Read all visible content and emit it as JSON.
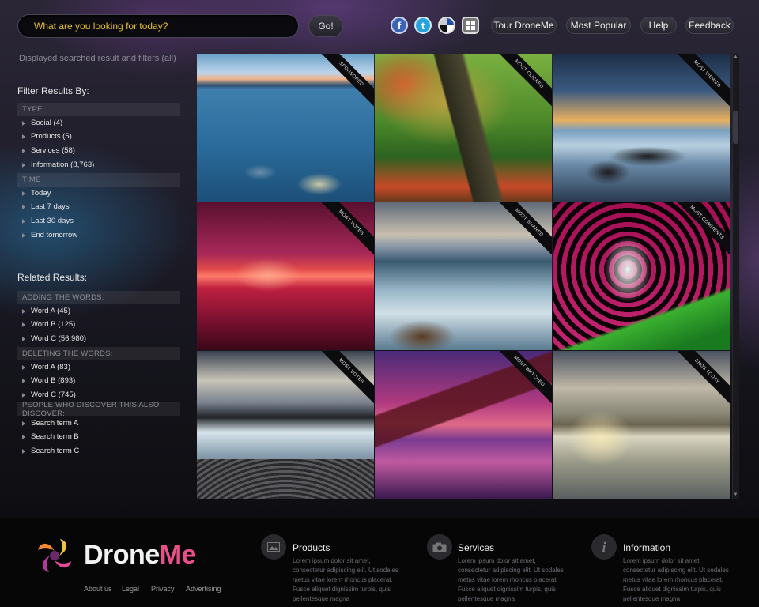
{
  "header": {
    "search_placeholder": "What are you looking for today?",
    "go_label": "Go!",
    "social": [
      {
        "name": "facebook-icon",
        "glyph": "f",
        "color": "#3b63b8"
      },
      {
        "name": "twitter-icon",
        "glyph": "t",
        "color": "#2aa3dc"
      },
      {
        "name": "delicious-icon",
        "glyph": "",
        "color": "#ffffff"
      },
      {
        "name": "bookmark-icon",
        "glyph": "",
        "color": "#9a9a9a"
      }
    ],
    "nav": [
      "Tour DroneMe",
      "Most Popular",
      "Help",
      "Feedback"
    ]
  },
  "sidebar": {
    "subtitle": "Displayed searched result and filters (all)",
    "filter_heading": "Filter Results By:",
    "type_head": "TYPE",
    "type_items": [
      "Social (4)",
      "Products (5)",
      "Services (58)",
      "Information (8,763)"
    ],
    "time_head": "TIME",
    "time_items": [
      "Today",
      "Last 7 days",
      "Last 30 days",
      "End tomorrow"
    ],
    "related_heading": "Related Results:",
    "adding_head": "ADDING THE WORDS:",
    "adding_items": [
      "Word A (45)",
      "Word B (125)",
      "Word C (56,980)"
    ],
    "deleting_head": "DELETING THE WORDS:",
    "deleting_items": [
      "Word A (83)",
      "Word B (893)",
      "Word C (745)"
    ],
    "discover_head": "PEOPLE WHO DISCOVER THIS ALSO DISCOVER:",
    "discover_items": [
      "Search term A",
      "Search term B",
      "Search term C"
    ]
  },
  "results": [
    {
      "ribbon": "SPONSORED",
      "scene": "lake-stones"
    },
    {
      "ribbon": "MOST CLICKED",
      "scene": "tree"
    },
    {
      "ribbon": "MOST VIEWED",
      "scene": "rocky-shore"
    },
    {
      "ribbon": "MOST VOTES",
      "scene": "bridge-night"
    },
    {
      "ribbon": "MOST SHARED",
      "scene": "waves"
    },
    {
      "ribbon": "MOST COMMENTS",
      "scene": "butterfly"
    },
    {
      "ribbon": "MOST VOTES",
      "scene": "pebble-beach"
    },
    {
      "ribbon": "MOST WATCHED",
      "scene": "forth-bridge"
    },
    {
      "ribbon": "ENDS TODAY",
      "scene": "town-reflection"
    }
  ],
  "footer": {
    "logo_part1": "Drone",
    "logo_part2": "Me",
    "links": [
      "About us",
      "Legal",
      "Privacy",
      "Advertising"
    ],
    "columns": [
      {
        "icon": "image-icon",
        "title": "Products",
        "text": "Lorem ipsum dolor sit amet, consectetur adipiscing elit. Ut sodales metus vitae lorem rhoncus placerat. Fusce aliquet dignissim turpis, quis pellentesque magna"
      },
      {
        "icon": "camera-icon",
        "title": "Services",
        "text": "Lorem ipsum dolor sit amet, consectetur adipiscing elit. Ut sodales metus vitae lorem rhoncus placerat. Fusce aliquet dignissim turpis, quis pellentesque magna"
      },
      {
        "icon": "info-icon",
        "title": "Information",
        "text": "Lorem ipsum dolor sit amet, consectetur adipiscing elit. Ut sodales metus vitae lorem rhoncus placerat. Fusce aliquet dignissim turpis, quis pellentesque magna"
      }
    ]
  },
  "colors": {
    "accent_yellow": "#e8c030",
    "logo_pink": "#e84a9a",
    "logo_orange": "#f08a30"
  }
}
